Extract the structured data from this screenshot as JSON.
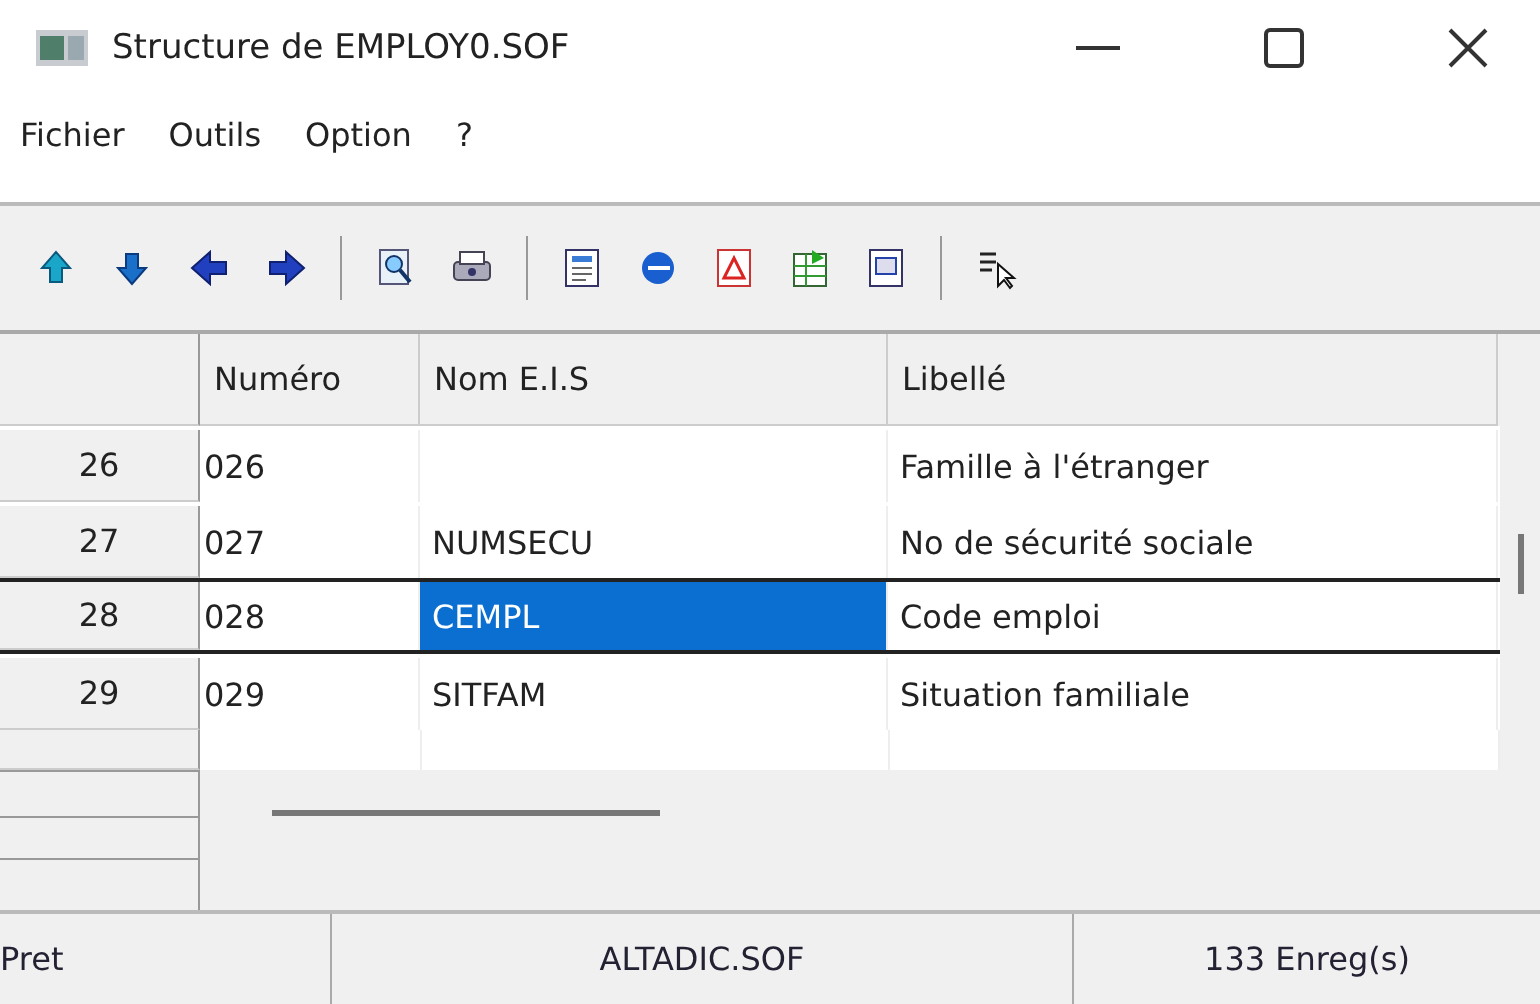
{
  "window": {
    "title": "Structure de EMPLOY0.SOF"
  },
  "menu": [
    "Fichier",
    "Outils",
    "Option",
    "?"
  ],
  "table": {
    "columns": [
      "Numéro",
      "Nom E.I.S",
      "Libellé"
    ],
    "rows": [
      {
        "header": "26",
        "selected": false,
        "cells": [
          {
            "text": "026",
            "selected": false
          },
          {
            "text": "",
            "selected": false
          },
          {
            "text": "Famille à l'étranger",
            "selected": false
          }
        ]
      },
      {
        "header": "27",
        "selected": false,
        "cells": [
          {
            "text": "027",
            "selected": false
          },
          {
            "text": "NUMSECU",
            "selected": false
          },
          {
            "text": "No de sécurité sociale",
            "selected": false
          }
        ]
      },
      {
        "header": "28",
        "selected": true,
        "cells": [
          {
            "text": "028",
            "selected": false
          },
          {
            "text": "CEMPL",
            "selected": true
          },
          {
            "text": "Code emploi",
            "selected": false
          }
        ]
      },
      {
        "header": "29",
        "selected": false,
        "cells": [
          {
            "text": "029",
            "selected": false
          },
          {
            "text": "SITFAM",
            "selected": false
          },
          {
            "text": "Situation familiale",
            "selected": false
          }
        ]
      }
    ]
  },
  "status_bar": [
    "Pret",
    "ALTADIC.SOF",
    "133 Enreg(s)"
  ]
}
